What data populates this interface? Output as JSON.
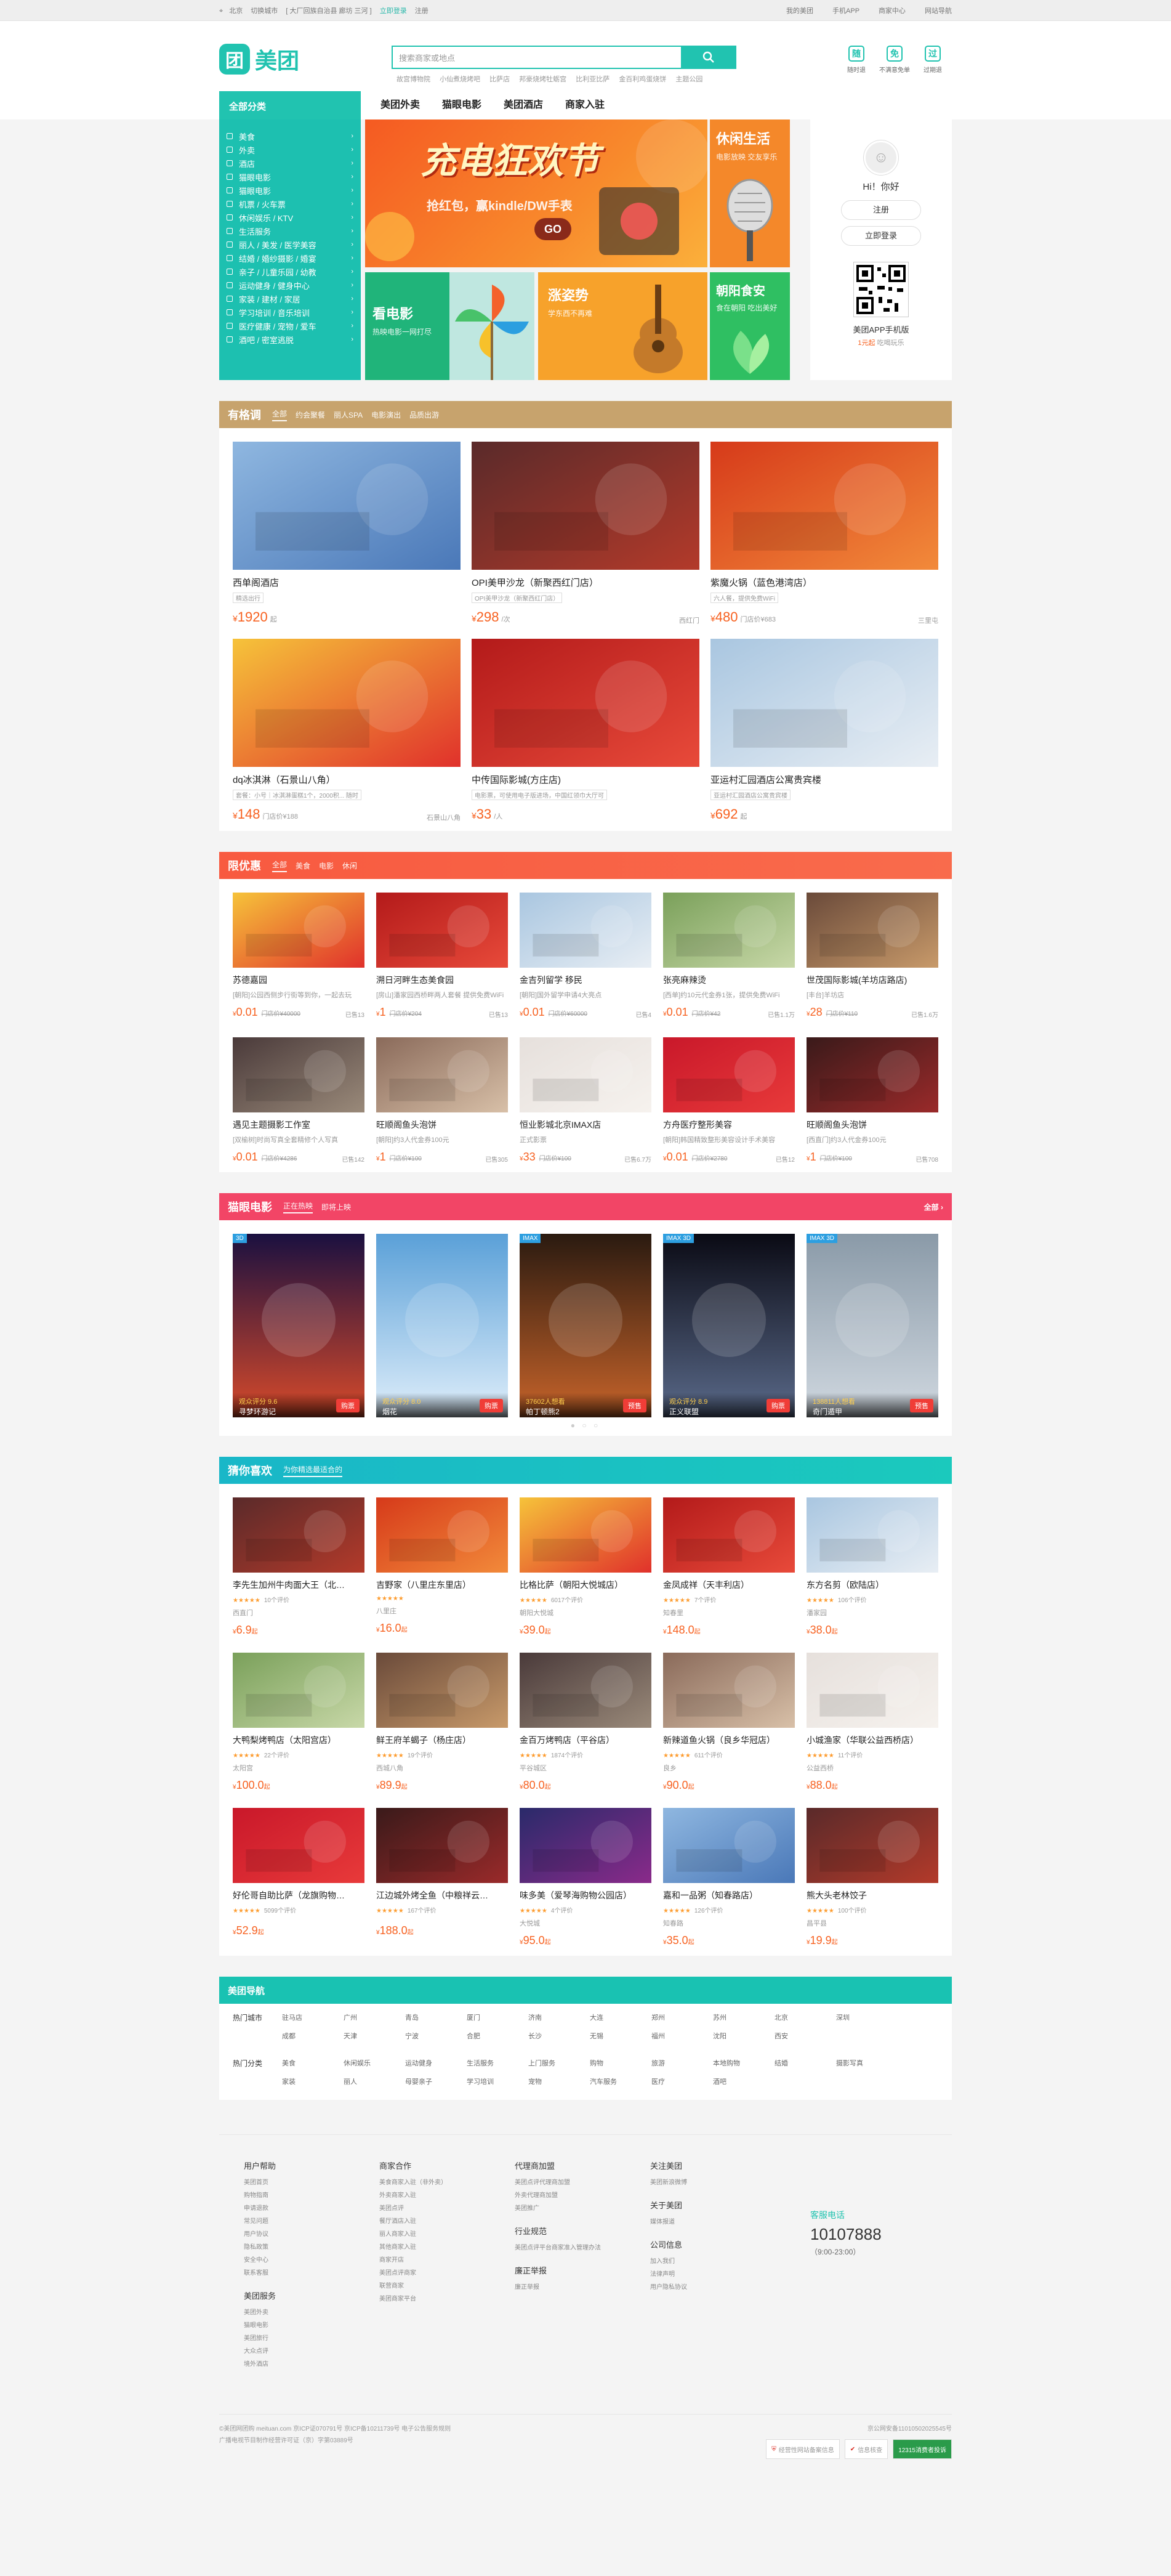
{
  "topbar": {
    "city": "北京",
    "switch": "切换城市",
    "near": "[ 大厂回族自治县 廊坊 三河 ]",
    "login": "立即登录",
    "register": "注册",
    "right": [
      "我的美团",
      "手机APP",
      "商家中心",
      "网站导航"
    ]
  },
  "header": {
    "logo_text": "美团",
    "search_placeholder": "搜索商家或地点",
    "hotwords": [
      "故宫博物院",
      "小仙煮烧烤吧",
      "比萨店",
      "邦豪烧烤牡蛎宫",
      "比利亚比萨",
      "金百利鸡蛋烧饼",
      "主题公园"
    ],
    "promises": [
      "随时退",
      "不满意免单",
      "过期退"
    ],
    "nav_all": "全部分类",
    "nav_tabs": [
      "美团外卖",
      "猫眼电影",
      "美团酒店",
      "商家入驻"
    ]
  },
  "categories": [
    "美食",
    "外卖",
    "酒店",
    "猫眼电影",
    "猫眼电影",
    "机票 / 火车票",
    "休闲娱乐 / KTV",
    "生活服务",
    "丽人 / 美发 / 医学美容",
    "结婚 / 婚纱摄影 / 婚宴",
    "亲子 / 儿童乐园 / 幼教",
    "运动健身 / 健身中心",
    "家装 / 建材 / 家居",
    "学习培训 / 音乐培训",
    "医疗健康 / 宠物 / 爱车",
    "酒吧 / 密室逃脱"
  ],
  "banners": {
    "main": {
      "title": "充电狂欢节",
      "sub": "抢红包，赢kindle/DW手表",
      "go": "GO"
    },
    "leisure": {
      "title": "休闲生活",
      "sub": "电影放映 交友享乐"
    },
    "movie": {
      "title": "看电影",
      "sub": "热映电影一网打尽"
    },
    "rise": {
      "title": "涨姿势",
      "sub": "学东西不再难"
    },
    "food": {
      "title": "朝阳食安",
      "sub": "食在朝阳 吃出美好"
    }
  },
  "profile": {
    "hi": "Hi！你好",
    "register": "注册",
    "login": "立即登录",
    "qr_title": "美团APP手机版",
    "qr_price": "1元起",
    "qr_sub": "吃喝玩乐"
  },
  "style_section": {
    "title": "有格调",
    "tabs": [
      "全部",
      "约会聚餐",
      "丽人SPA",
      "电影演出",
      "品质出游"
    ],
    "items": [
      {
        "name": "西单阁酒店",
        "sub": "精选出行",
        "price": "1920",
        "unit": "起",
        "loc": ""
      },
      {
        "name": "OPI美甲沙龙（新聚西红门店）",
        "sub": "OPI美甲沙龙（新聚西红门店）",
        "price": "298",
        "unit": "/次",
        "loc": "西红门"
      },
      {
        "name": "紫魔火锅（蓝色港湾店）",
        "sub": "六人餐，提供免费WiFi",
        "price": "480",
        "unit": "门店价¥683",
        "loc": "三里屯"
      },
      {
        "name": "dq冰淇淋（石景山八角）",
        "sub": "套餐：小号｜冰淇淋蛋糕1个，2000积... 随时",
        "price": "148",
        "unit": "门店价¥188",
        "loc": "石景山八角"
      },
      {
        "name": "中传国际影城(方庄店)",
        "sub": "电影票，可使用电子版进场，中国红领巾大厅可",
        "price": "33",
        "unit": "/人",
        "loc": ""
      },
      {
        "name": "亚运村汇园酒店公寓贵宾楼",
        "sub": "亚运村汇园酒店公寓贵宾楼",
        "price": "692",
        "unit": "起",
        "loc": ""
      }
    ]
  },
  "deal_section": {
    "title": "限优惠",
    "tabs": [
      "全部",
      "美食",
      "电影",
      "休闲"
    ],
    "items": [
      {
        "name": "苏德嘉园",
        "sub": "[朝阳]公园西侧步行街等到你，一起去玩",
        "price": "0.01",
        "orig": "门店价¥40000",
        "sold": "已售13"
      },
      {
        "name": "溯日河畔生态美食园",
        "sub": "[房山]潘家园西桥畔两人套餐 提供免费WiFi",
        "price": "1",
        "orig": "门店价¥204",
        "sold": "已售13"
      },
      {
        "name": "金吉列留学 移民",
        "sub": "[朝阳]国外留学申请4大亮点",
        "price": "0.01",
        "orig": "门店价¥60000",
        "sold": "已售4"
      },
      {
        "name": "张亮麻辣烫",
        "sub": "[西单]约10元代金券1张，提供免费WiFi",
        "price": "0.01",
        "orig": "门店价¥42",
        "sold": "已售1.1万"
      },
      {
        "name": "世茂国际影城(羊坊店路店)",
        "sub": "[丰台]羊坊店",
        "price": "28",
        "orig": "门店价¥110",
        "sold": "已售1.6万"
      },
      {
        "name": "遇见主题摄影工作室",
        "sub": "[双榆树]时尚写真全套精修个人写真",
        "price": "0.01",
        "orig": "门店价¥4286",
        "sold": "已售142"
      },
      {
        "name": "旺顺阁鱼头泡饼",
        "sub": "[朝阳]约3人代金券100元",
        "price": "1",
        "orig": "门店价¥100",
        "sold": "已售305"
      },
      {
        "name": "恒业影城北京IMAX店",
        "sub": "正式影票",
        "price": "33",
        "orig": "门店价¥100",
        "sold": "已售6.7万"
      },
      {
        "name": "方舟医疗整形美容",
        "sub": "[朝阳]韩国精致整形美容设计手术美容",
        "price": "0.01",
        "orig": "门店价¥2780",
        "sold": "已售12"
      },
      {
        "name": "旺顺阁鱼头泡饼",
        "sub": "[西直门]约3人代金券100元",
        "price": "1",
        "orig": "门店价¥100",
        "sold": "已售708"
      }
    ]
  },
  "movie_section": {
    "title": "猫眼电影",
    "tabs": [
      "正在热映",
      "即将上映"
    ],
    "more": "全部 ›",
    "items": [
      {
        "name": "寻梦环游记",
        "score": "观众评分 9.6",
        "action": "购票",
        "flag": "3D"
      },
      {
        "name": "烟花",
        "score": "观众评分 8.0",
        "action": "购票",
        "flag": ""
      },
      {
        "name": "帕丁顿熊2",
        "score": "37602人想看",
        "action": "预售",
        "flag": "IMAX"
      },
      {
        "name": "正义联盟",
        "score": "观众评分 8.9",
        "action": "购票",
        "flag": "IMAX 3D"
      },
      {
        "name": "奇门遁甲",
        "score": "138811人想看",
        "action": "预售",
        "flag": "IMAX 3D"
      }
    ]
  },
  "like_section": {
    "title": "猜你喜欢",
    "tabs": [
      "为你精选最适合的"
    ],
    "items": [
      {
        "name": "李先生加州牛肉面大王（北…",
        "reviews": "10个评价",
        "area": "西直门",
        "price": "6.9"
      },
      {
        "name": "吉野家（八里庄东里店）",
        "reviews": "",
        "area": "八里庄",
        "price": "16.0"
      },
      {
        "name": "比格比萨（朝阳大悦城店）",
        "reviews": "6017个评价",
        "area": "朝阳大悦城",
        "price": "39.0"
      },
      {
        "name": "金凤成祥（天丰利店）",
        "reviews": "7个评价",
        "area": "知春里",
        "price": "148.0"
      },
      {
        "name": "东方名剪（欧陆店）",
        "reviews": "106个评价",
        "area": "潘家园",
        "price": "38.0"
      },
      {
        "name": "大鸭梨烤鸭店（太阳宫店）",
        "reviews": "22个评价",
        "area": "太阳宫",
        "price": "100.0"
      },
      {
        "name": "鲜王府羊蝎子（杨庄店）",
        "reviews": "19个评价",
        "area": "西城八角",
        "price": "89.9"
      },
      {
        "name": "金百万烤鸭店（平谷店）",
        "reviews": "1874个评价",
        "area": "平谷城区",
        "price": "80.0"
      },
      {
        "name": "新辣道鱼火锅（良乡华冠店）",
        "reviews": "611个评价",
        "area": "良乡",
        "price": "90.0"
      },
      {
        "name": "小城渔家（华联公益西桥店）",
        "reviews": "11个评价",
        "area": "公益西桥",
        "price": "88.0"
      },
      {
        "name": "好伦哥自助比萨（龙旗购物…",
        "reviews": "5099个评价",
        "area": "",
        "price": "52.9"
      },
      {
        "name": "江边城外烤全鱼（中粮祥云…",
        "reviews": "167个评价",
        "area": "",
        "price": "188.0"
      },
      {
        "name": "味多美（爱琴海购物公园店）",
        "reviews": "4个评价",
        "area": "大悦城",
        "price": "95.0"
      },
      {
        "name": "嘉和一品粥（知春路店）",
        "reviews": "126个评价",
        "area": "知春路",
        "price": "35.0"
      },
      {
        "name": "熊大头老林饺子",
        "reviews": "100个评价",
        "area": "昌平县",
        "price": "19.9"
      }
    ]
  },
  "nav_section": {
    "title": "美团导航",
    "hot_city_label": "热门城市",
    "cities": [
      "驻马店",
      "广州",
      "青岛",
      "厦门",
      "济南",
      "大连",
      "郑州",
      "苏州",
      "北京",
      "深圳",
      "成都",
      "天津",
      "宁波",
      "合肥",
      "长沙",
      "无锡",
      "福州",
      "沈阳",
      "西安"
    ],
    "hot_cat_label": "热门分类",
    "hot_cats": [
      "美食",
      "休闲娱乐",
      "运动健身",
      "生活服务",
      "上门服务",
      "购物",
      "旅游",
      "本地购物",
      "结婚",
      "摄影写真",
      "家装",
      "丽人",
      "母婴亲子",
      "学习培训",
      "宠物",
      "汽车服务",
      "医疗",
      "酒吧"
    ]
  },
  "footer": {
    "cols": [
      {
        "h": "用户帮助",
        "items": [
          "美团首页",
          "购物指南",
          "申请退款",
          "常见问题",
          "用户协议",
          "隐私政策",
          "安全中心",
          "联系客服"
        ]
      },
      {
        "h": "商家合作",
        "items": [
          "美食商家入驻（非外卖）",
          "外卖商家入驻",
          "美团点评",
          "餐厅酒店入驻",
          "丽人商家入驻",
          "其他商家入驻",
          "商家开店",
          "美团点评商家",
          "联营商家",
          "美团商家平台"
        ]
      },
      {
        "h": "代理商加盟",
        "items": [
          "美团点评代理商加盟",
          "外卖代理商加盟",
          "美团推广"
        ]
      },
      {
        "h": "关注美团",
        "items": [
          "美团新浪微博"
        ]
      }
    ],
    "col2_h2": "美团服务",
    "col2_items2": [
      "美团外卖",
      "猫眼电影",
      "美团旅行",
      "大众点评",
      "境外酒店"
    ],
    "col3_h2": "行业规范",
    "col3_items2": [
      "美团点评平台商家准入管理办法"
    ],
    "col3_h3": "廉正举报",
    "col3_items3": [
      "廉正举报"
    ],
    "col4_h2": "关于美团",
    "col4_items2": [
      "媒体报道"
    ],
    "col4_h3": "公司信息",
    "col4_items3": [
      "加入我们",
      "法律声明",
      "用户隐私协议"
    ],
    "kf_title": "客服电话",
    "kf_phone": "10107888",
    "kf_hours": "（9:00-23:00）",
    "copyright": "©美团网团购 meituan.com 京ICP证070791号 京ICP备10211739号 电子公告服务规则",
    "copyright2": "广播电视节目制作经营许可证（京）字第03889号",
    "icp_right": "京公网安备11010502025545号",
    "badges": [
      "经营性网站备案信息",
      "信息核查",
      "12315消费者投诉"
    ]
  },
  "colors": {
    "brand": "#21c3b0",
    "price": "#f76120",
    "style_head": "#c7a36d",
    "deal_head": "#f85a40",
    "movie_head": "#f24566",
    "like_head": "#19b7c8",
    "nav_head": "#19c2b2"
  }
}
